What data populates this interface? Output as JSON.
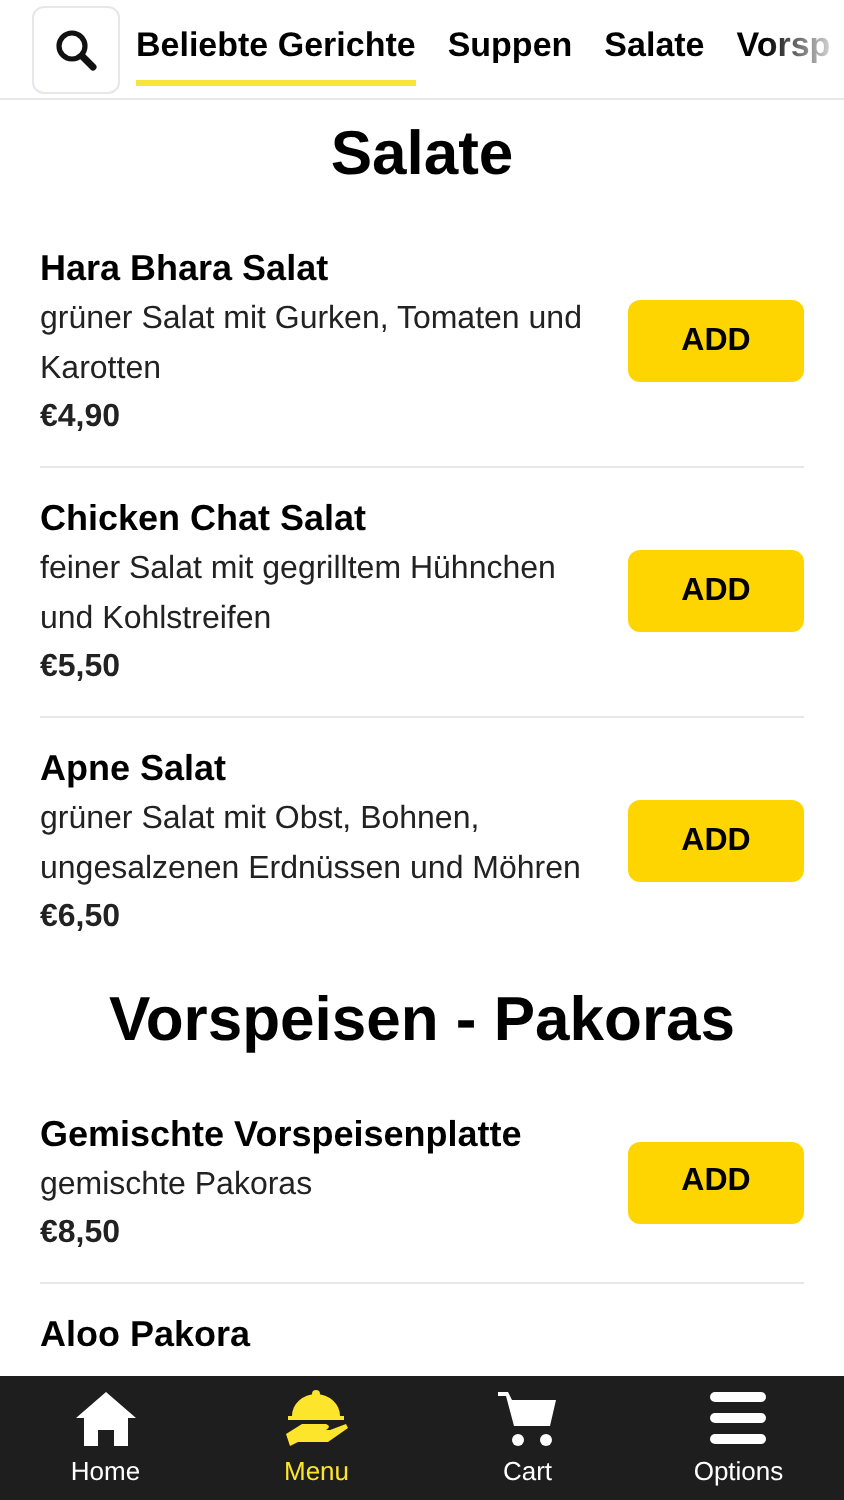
{
  "tabs": [
    {
      "label": "Beliebte Gerichte",
      "selected": true
    },
    {
      "label": "Suppen",
      "selected": false
    },
    {
      "label": "Salate",
      "selected": false
    },
    {
      "label": "Vorsp",
      "selected": false
    }
  ],
  "sections": [
    {
      "title": "Salate",
      "items": [
        {
          "name": "Hara Bhara Salat",
          "description": "grüner Salat mit Gurken, Tomaten und Karotten",
          "price": "€4,90",
          "button": "ADD"
        },
        {
          "name": "Chicken Chat Salat",
          "description": "feiner Salat mit gegrilltem Hühnchen und Kohlstreifen",
          "price": "€5,50",
          "button": "ADD"
        },
        {
          "name": "Apne Salat",
          "description": "grüner Salat mit Obst, Bohnen, ungesalzenen Erdnüssen und Möhren",
          "price": "€6,50",
          "button": "ADD"
        }
      ]
    },
    {
      "title": "Vorspeisen - Pakoras",
      "items": [
        {
          "name": "Gemischte Vorspeisenplatte",
          "description": "gemischte Pakoras",
          "price": "€8,50",
          "button": "ADD"
        },
        {
          "name": "Aloo Pakora"
        }
      ]
    }
  ],
  "nav": [
    {
      "kind": "home",
      "label": "Home",
      "selected": false
    },
    {
      "kind": "menu",
      "label": "Menu",
      "selected": true
    },
    {
      "kind": "cart",
      "label": "Cart",
      "selected": false
    },
    {
      "kind": "options",
      "label": "Options",
      "selected": false
    }
  ]
}
